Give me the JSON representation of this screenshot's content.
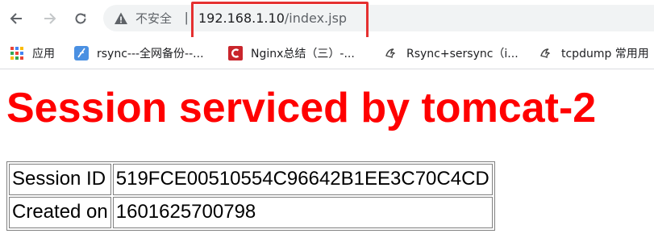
{
  "browser": {
    "security_label": "不安全",
    "separator": "|",
    "url_host": "192.168.1.10",
    "url_path": "/index.jsp"
  },
  "bookmarks": [
    {
      "label": "应用",
      "icon": "apps-grid-icon"
    },
    {
      "label": "rsync---全网备份--...",
      "icon": "feather-icon"
    },
    {
      "label": "Nginx总结（三）-...",
      "icon": "csdn-c-icon"
    },
    {
      "label": "Rsync+sersync（i...",
      "icon": "bird-logo-icon"
    },
    {
      "label": "tcpdump 常用用",
      "icon": "bird-logo-icon"
    }
  ],
  "page": {
    "title": "Session serviced by tomcat-2",
    "rows": [
      {
        "key": "Session ID",
        "value": "519FCE00510554C96642B1EE3C70C4CD"
      },
      {
        "key": "Created on",
        "value": "1601625700798"
      }
    ]
  },
  "colors": {
    "title": "#ff0000",
    "highlight_box": "#e53030",
    "csdn_red": "#c9252c",
    "feather_blue": "#4a90e2"
  }
}
